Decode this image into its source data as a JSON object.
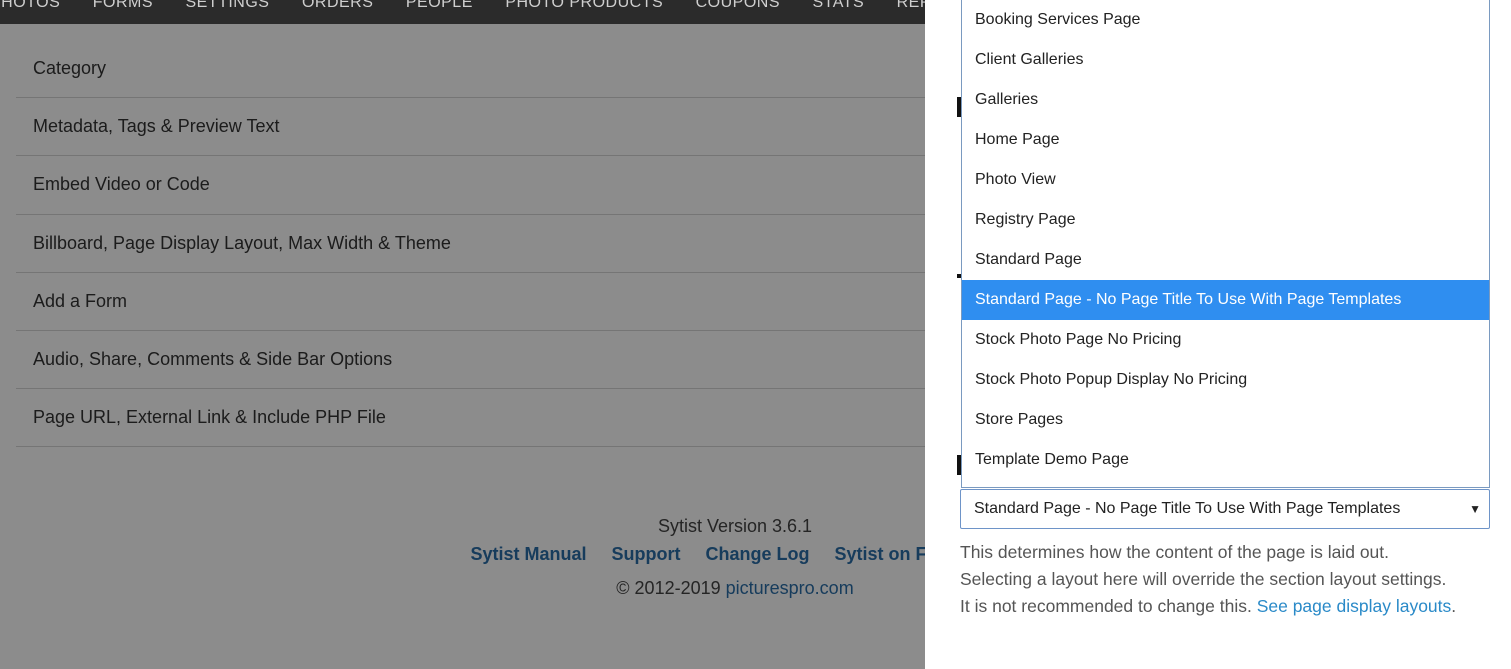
{
  "nav": {
    "items": [
      "PHOTOS",
      "FORMS",
      "SETTINGS",
      "ORDERS",
      "PEOPLE",
      "PHOTO PRODUCTS",
      "COUPONS",
      "STATS",
      "REPORTS"
    ]
  },
  "sections": [
    "Category",
    "Metadata, Tags & Preview Text",
    "Embed Video or Code",
    "Billboard, Page Display Layout, Max Width & Theme",
    "Add a Form",
    "Audio, Share, Comments & Side Bar Options",
    "Page URL, External Link & Include PHP File"
  ],
  "footer": {
    "version": "Sytist Version 3.6.1",
    "links": [
      "Sytist Manual",
      "Support",
      "Change Log",
      "Sytist on Facebook"
    ],
    "copyright": "© 2012-2019 ",
    "copyright_link": "picturespro.com"
  },
  "layout_select": {
    "options": [
      "Booking Services Page",
      "Client Galleries",
      "Galleries",
      "Home Page",
      "Photo View",
      "Registry Page",
      "Standard Page",
      "Standard Page - No Page Title To Use With Page Templates",
      "Stock Photo Page No Pricing",
      "Stock Photo Popup Display No Pricing",
      "Store Pages",
      "Template Demo Page"
    ],
    "selected_index": 7,
    "value": "Standard Page - No Page Title To Use With Page Templates"
  },
  "help": {
    "line1": "This determines how the content of the page is laid out.",
    "line2": "Selecting a layout here will override the section layout settings.",
    "line3": "It is not recommended to change this. ",
    "link": "See page display layouts",
    "link_suffix": "."
  },
  "colors": {
    "selected_option": "#2f8ef0",
    "link": "#2a6ea8",
    "nav_bg": "#2b2b2b"
  }
}
